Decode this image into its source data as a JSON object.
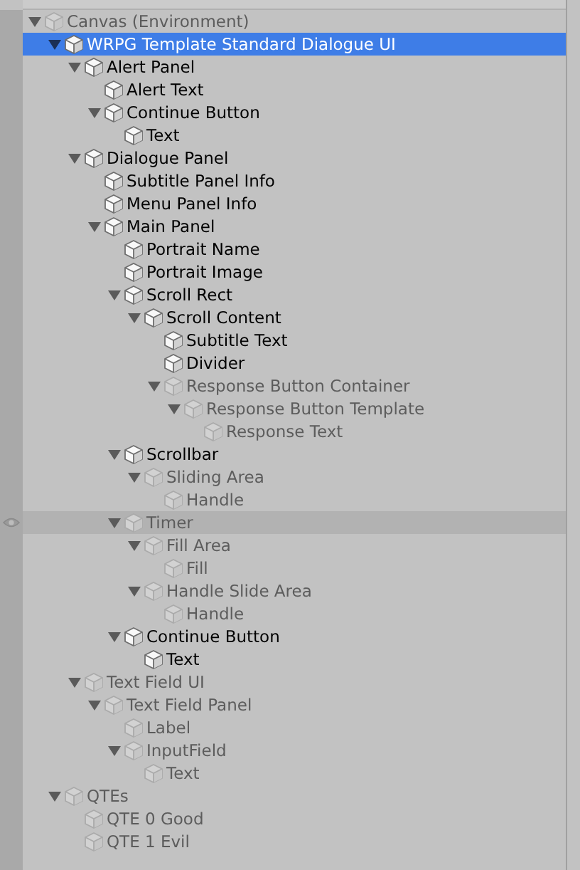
{
  "tree": [
    {
      "name": "Canvas (Environment)",
      "active": false,
      "selected": false,
      "hovered": false,
      "expanded": true,
      "children": [
        {
          "name": "WRPG Template Standard Dialogue UI",
          "active": true,
          "selected": true,
          "hovered": false,
          "expanded": true,
          "children": [
            {
              "name": "Alert Panel",
              "active": true,
              "selected": false,
              "hovered": false,
              "expanded": true,
              "children": [
                {
                  "name": "Alert Text",
                  "active": true,
                  "selected": false,
                  "hovered": false
                },
                {
                  "name": "Continue Button",
                  "active": true,
                  "selected": false,
                  "hovered": false,
                  "expanded": true,
                  "children": [
                    {
                      "name": "Text",
                      "active": true,
                      "selected": false,
                      "hovered": false
                    }
                  ]
                }
              ]
            },
            {
              "name": "Dialogue Panel",
              "active": true,
              "selected": false,
              "hovered": false,
              "expanded": true,
              "children": [
                {
                  "name": "Subtitle Panel Info",
                  "active": true,
                  "selected": false,
                  "hovered": false
                },
                {
                  "name": "Menu Panel Info",
                  "active": true,
                  "selected": false,
                  "hovered": false
                },
                {
                  "name": "Main Panel",
                  "active": true,
                  "selected": false,
                  "hovered": false,
                  "expanded": true,
                  "children": [
                    {
                      "name": "Portrait Name",
                      "active": true,
                      "selected": false,
                      "hovered": false
                    },
                    {
                      "name": "Portrait Image",
                      "active": true,
                      "selected": false,
                      "hovered": false
                    },
                    {
                      "name": "Scroll Rect",
                      "active": true,
                      "selected": false,
                      "hovered": false,
                      "expanded": true,
                      "children": [
                        {
                          "name": "Scroll Content",
                          "active": true,
                          "selected": false,
                          "hovered": false,
                          "expanded": true,
                          "children": [
                            {
                              "name": "Subtitle Text",
                              "active": true,
                              "selected": false,
                              "hovered": false
                            },
                            {
                              "name": "Divider",
                              "active": true,
                              "selected": false,
                              "hovered": false
                            },
                            {
                              "name": "Response Button Container",
                              "active": false,
                              "selected": false,
                              "hovered": false,
                              "expanded": true,
                              "children": [
                                {
                                  "name": "Response Button Template",
                                  "active": false,
                                  "selected": false,
                                  "hovered": false,
                                  "expanded": true,
                                  "children": [
                                    {
                                      "name": "Response Text",
                                      "active": false,
                                      "selected": false,
                                      "hovered": false
                                    }
                                  ]
                                }
                              ]
                            }
                          ]
                        }
                      ]
                    },
                    {
                      "name": "Scrollbar",
                      "active": true,
                      "selected": false,
                      "hovered": false,
                      "expanded": true,
                      "children": [
                        {
                          "name": "Sliding Area",
                          "active": false,
                          "selected": false,
                          "hovered": false,
                          "expanded": true,
                          "children": [
                            {
                              "name": "Handle",
                              "active": false,
                              "selected": false,
                              "hovered": false
                            }
                          ]
                        }
                      ]
                    },
                    {
                      "name": "Timer",
                      "active": false,
                      "selected": false,
                      "hovered": true,
                      "expanded": true,
                      "children": [
                        {
                          "name": "Fill Area",
                          "active": false,
                          "selected": false,
                          "hovered": false,
                          "expanded": true,
                          "children": [
                            {
                              "name": "Fill",
                              "active": false,
                              "selected": false,
                              "hovered": false
                            }
                          ]
                        },
                        {
                          "name": "Handle Slide Area",
                          "active": false,
                          "selected": false,
                          "hovered": false,
                          "expanded": true,
                          "children": [
                            {
                              "name": "Handle",
                              "active": false,
                              "selected": false,
                              "hovered": false
                            }
                          ]
                        }
                      ]
                    },
                    {
                      "name": "Continue Button",
                      "active": true,
                      "selected": false,
                      "hovered": false,
                      "expanded": true,
                      "children": [
                        {
                          "name": "Text",
                          "active": true,
                          "selected": false,
                          "hovered": false
                        }
                      ]
                    }
                  ]
                }
              ]
            },
            {
              "name": "Text Field UI",
              "active": false,
              "selected": false,
              "hovered": false,
              "expanded": true,
              "children": [
                {
                  "name": "Text Field Panel",
                  "active": false,
                  "selected": false,
                  "hovered": false,
                  "expanded": true,
                  "children": [
                    {
                      "name": "Label",
                      "active": false,
                      "selected": false,
                      "hovered": false
                    },
                    {
                      "name": "InputField",
                      "active": false,
                      "selected": false,
                      "hovered": false,
                      "expanded": true,
                      "children": [
                        {
                          "name": "Text",
                          "active": false,
                          "selected": false,
                          "hovered": false
                        }
                      ]
                    }
                  ]
                }
              ]
            }
          ]
        },
        {
          "name": "QTEs",
          "active": false,
          "selected": false,
          "hovered": false,
          "expanded": true,
          "children": [
            {
              "name": "QTE 0 Good",
              "active": false,
              "selected": false,
              "hovered": false
            },
            {
              "name": "QTE 1 Evil",
              "active": false,
              "selected": false,
              "hovered": false
            }
          ]
        }
      ]
    }
  ]
}
